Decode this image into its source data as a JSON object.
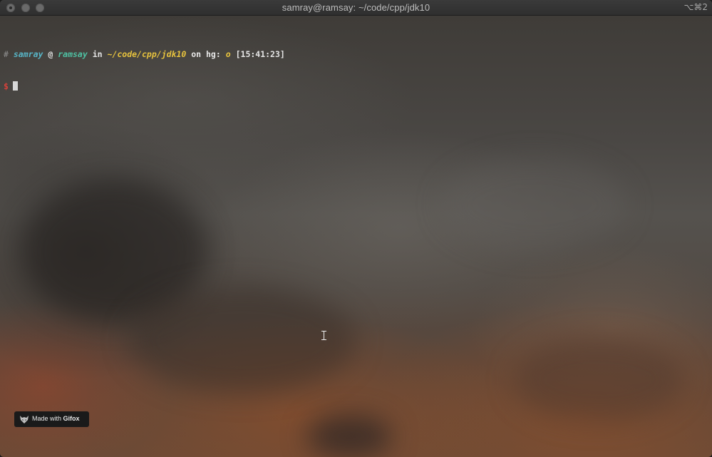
{
  "window": {
    "title": "samray@ramsay: ~/code/cpp/jdk10",
    "shortcut": "⌥⌘2"
  },
  "prompt": {
    "hash": "#",
    "user": "samray",
    "at": "@",
    "host": "ramsay",
    "in": "in",
    "path": "~/code/cpp/jdk10",
    "on": "on hg:",
    "vcs_status": "o",
    "time": "[15:41:23]",
    "symbol": "$"
  },
  "badge": {
    "made_with": "Made with",
    "brand": "Gifox"
  },
  "colors": {
    "user": "#58b6c8",
    "host": "#4fc1a3",
    "path": "#e7c33e",
    "dollar": "#d6413a"
  },
  "icons": [
    "close-icon",
    "fox-logo-icon",
    "text-cursor-icon"
  ]
}
